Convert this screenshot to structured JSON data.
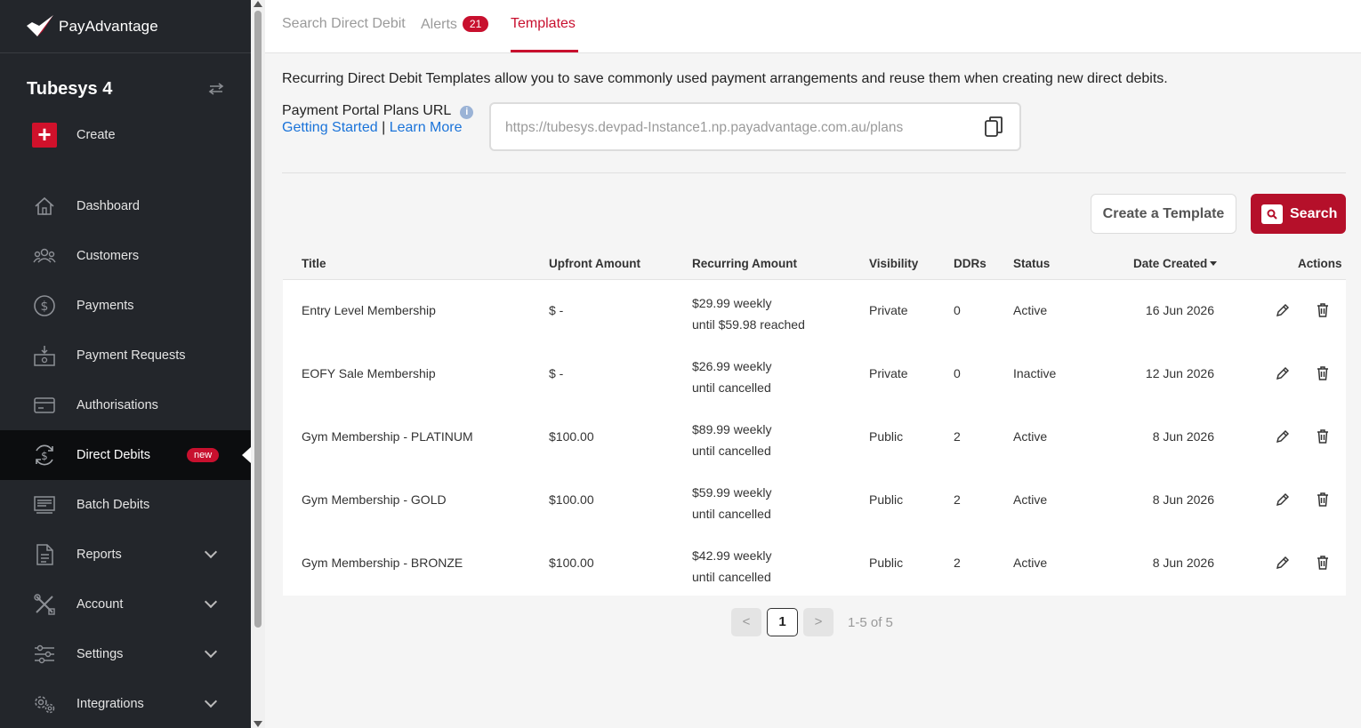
{
  "brand": {
    "name": "PayAdvantage",
    "accent": "#c8102e"
  },
  "sidebar": {
    "org_name": "Tubesys 4",
    "create_label": "Create",
    "items": [
      {
        "label": "Dashboard",
        "icon": "home-icon"
      },
      {
        "label": "Customers",
        "icon": "users-icon"
      },
      {
        "label": "Payments",
        "icon": "dollar-circle-icon"
      },
      {
        "label": "Payment Requests",
        "icon": "payment-request-icon"
      },
      {
        "label": "Authorisations",
        "icon": "card-icon"
      },
      {
        "label": "Direct Debits",
        "icon": "recurring-dollar-icon",
        "badge": "new",
        "active": true
      },
      {
        "label": "Batch Debits",
        "icon": "batch-icon"
      },
      {
        "label": "Reports",
        "icon": "document-icon"
      },
      {
        "label": "Account",
        "icon": "tools-icon"
      },
      {
        "label": "Settings",
        "icon": "sliders-icon"
      },
      {
        "label": "Integrations",
        "icon": "gears-icon"
      }
    ]
  },
  "tabs": {
    "search": "Search Direct Debit",
    "alerts": "Alerts",
    "alerts_count": "21",
    "templates": "Templates"
  },
  "intro_text": "Recurring Direct Debit Templates allow you to save commonly used payment arrangements and reuse them when creating new direct debits.",
  "portal": {
    "label": "Payment Portal Plans URL",
    "getting_started": "Getting Started",
    "separator": "|",
    "learn_more": "Learn More",
    "url_placeholder": "https://tubesys.devpad-Instance1.np.payadvantage.com.au/plans"
  },
  "buttons": {
    "create_template": "Create a Template",
    "search": "Search"
  },
  "table": {
    "headers": {
      "title": "Title",
      "upfront": "Upfront Amount",
      "recurring": "Recurring Amount",
      "visibility": "Visibility",
      "ddrs": "DDRs",
      "status": "Status",
      "date_created": "Date Created",
      "actions": "Actions"
    },
    "rows": [
      {
        "title": "Entry Level Membership",
        "upfront": "$ -",
        "recurring_1": "$29.99 weekly",
        "recurring_2": "until $59.98 reached",
        "visibility": "Private",
        "ddrs": "0",
        "status": "Active",
        "date": "16 Jun 2026"
      },
      {
        "title": "EOFY Sale Membership",
        "upfront": "$ -",
        "recurring_1": "$26.99 weekly",
        "recurring_2": "until cancelled",
        "visibility": "Private",
        "ddrs": "0",
        "status": "Inactive",
        "date": "12 Jun 2026"
      },
      {
        "title": "Gym Membership - PLATINUM",
        "upfront": "$100.00",
        "recurring_1": "$89.99 weekly",
        "recurring_2": "until cancelled",
        "visibility": "Public",
        "ddrs": "2",
        "status": "Active",
        "date": "8 Jun 2026"
      },
      {
        "title": "Gym Membership - GOLD",
        "upfront": "$100.00",
        "recurring_1": "$59.99 weekly",
        "recurring_2": "until cancelled",
        "visibility": "Public",
        "ddrs": "2",
        "status": "Active",
        "date": "8 Jun 2026"
      },
      {
        "title": "Gym Membership - BRONZE",
        "upfront": "$100.00",
        "recurring_1": "$42.99 weekly",
        "recurring_2": "until cancelled",
        "visibility": "Public",
        "ddrs": "2",
        "status": "Active",
        "date": "8 Jun 2026"
      }
    ]
  },
  "pagination": {
    "prev": "<",
    "page": "1",
    "next": ">",
    "info": "1-5 of 5"
  }
}
